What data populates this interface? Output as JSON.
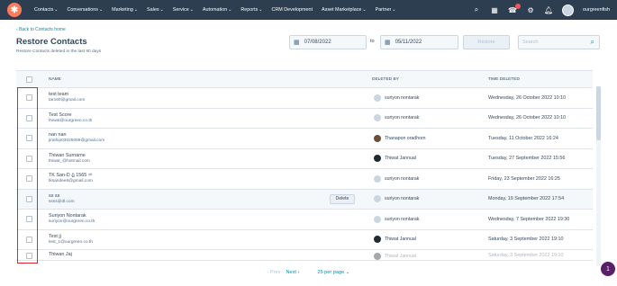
{
  "nav": {
    "items": [
      "Contacts",
      "Conversations",
      "Marketing",
      "Sales",
      "Service",
      "Automation",
      "Reports",
      "CRM Development",
      "Asset Marketplace",
      "Partner"
    ],
    "account": "ourgreenfish"
  },
  "header": {
    "back_link": "Back to Contacts home",
    "title": "Restore Contacts",
    "subtitle": "Restore Contacts deleted in the last 90 days",
    "date_from": "07/08/2022",
    "to_label": "to",
    "date_to": "05/11/2022",
    "restore_label": "Restore",
    "search_placeholder": "Search"
  },
  "table": {
    "headers": [
      "NAME",
      "DELETED BY",
      "TIME DELETED"
    ],
    "delete_label": "Delete",
    "rows": [
      {
        "name": "test team",
        "email": "tar160@gmail.com",
        "by": "suriyon nontarak",
        "time": "Wednesday, 26 October 2022 10:10"
      },
      {
        "name": "Test Score",
        "email": "thiwat@ourgreen.co.th",
        "by": "suriyon nontarak",
        "time": "Wednesday, 26 October 2022 10:10"
      },
      {
        "name": "nan nan",
        "email": "jirathip03025069@gmail.com",
        "by": "Thanapon oradhorn",
        "time": "Tuesday, 11 October 2022 16:24"
      },
      {
        "name": "Thiwan Surname",
        "email": "thiwat_@hotmail.com",
        "by": "Thiwat Jannual",
        "time": "Tuesday, 27 September 2022 15:56"
      },
      {
        "name": "TK San-D ฎ 1565 ♾",
        "email": "tksandee6@gmail.com",
        "by": "suriyon nontarak",
        "time": "Friday, 23 September 2022 16:25"
      },
      {
        "name": "ss ss",
        "email": "ssss@dl.com",
        "by": "suriyon nontarak",
        "time": "Monday, 19 September 2022 17:54"
      },
      {
        "name": "Suriyon Nontarak",
        "email": "suriyon@ourgreen.co.th",
        "by": "suriyon nontarak",
        "time": "Wednesday, 7 September 2022 19:30"
      },
      {
        "name": "Test jj",
        "email": "test_1@ourgreen.co.th",
        "by": "Thiwat Jannual",
        "time": "Saturday, 3 September 2022 19:10"
      },
      {
        "name": "Thiwan Jaj",
        "email": "",
        "by": "Thiwat Jannual",
        "time": "Saturday, 3 September 2022 19:10"
      }
    ]
  },
  "pager": {
    "prev": "Prev",
    "next": "Next",
    "per_page": "25 per page"
  },
  "chat_count": "1"
}
